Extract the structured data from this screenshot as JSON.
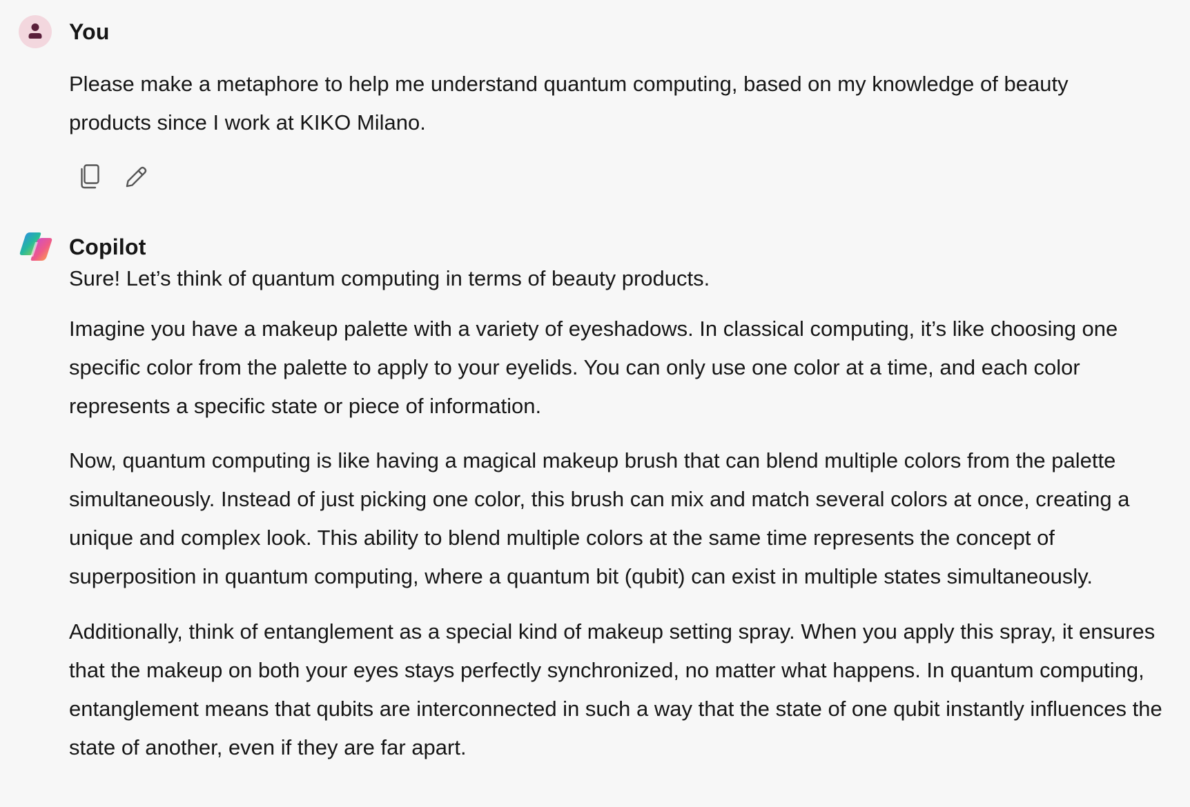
{
  "user_message": {
    "sender": "You",
    "text": "Please make a metaphore to help me understand quantum computing, based on my knowledge of beauty products since I work at KIKO Milano.",
    "actions": {
      "copy_icon": "copy-icon",
      "edit_icon": "pencil-icon"
    }
  },
  "copilot_message": {
    "sender": "Copilot",
    "paragraphs": [
      "Sure! Let’s think of quantum computing in terms of beauty products.",
      "Imagine you have a makeup palette with a variety of eyeshadows. In classical computing, it’s like choosing one specific color from the palette to apply to your eyelids. You can only use one color at a time, and each color represents a specific state or piece of information.",
      "Now, quantum computing is like having a magical makeup brush that can blend multiple colors from the palette simultaneously. Instead of just picking one color, this brush can mix and match several colors at once, creating a unique and complex look. This ability to blend multiple colors at the same time represents the concept of superposition in quantum computing, where a quantum bit (qubit) can exist in multiple states simultaneously.",
      "Additionally, think of entanglement as a special kind of makeup setting spray. When you apply this spray, it ensures that the makeup on both your eyes stays perfectly synchronized, no matter what happens. In quantum computing, entanglement means that qubits are interconnected in such a way that the state of one qubit instantly influences the state of another, even if they are far apart."
    ]
  },
  "colors": {
    "background": "#f7f7f7",
    "user_avatar_bg": "#f3d7de",
    "user_avatar_fg": "#5a1f3a",
    "text": "#161616"
  }
}
